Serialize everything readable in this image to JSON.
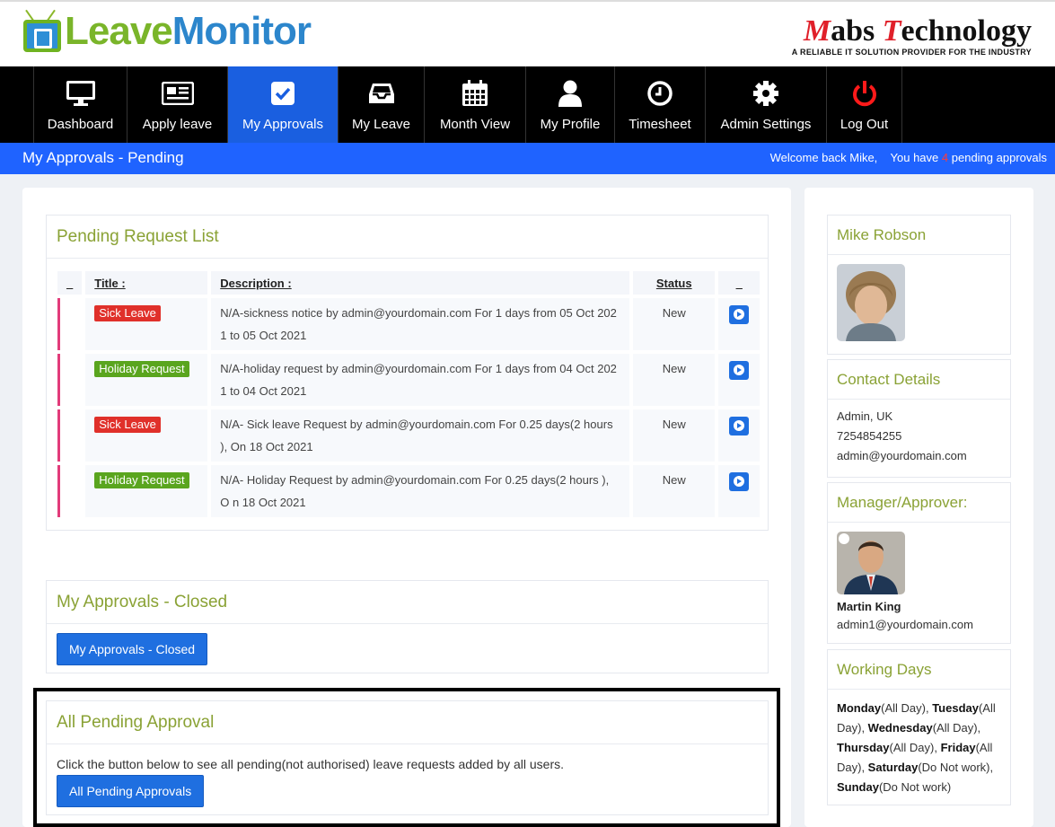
{
  "header": {
    "logo_part1": "Leave",
    "logo_part2": "Monitor",
    "brand_part1": "M",
    "brand_part2": "abs ",
    "brand_part3": "T",
    "brand_part4": "echnology",
    "brand_tagline": "A RELIABLE IT SOLUTION PROVIDER FOR THE INDUSTRY"
  },
  "nav": {
    "items": [
      {
        "label": "Dashboard",
        "icon": "monitor-icon"
      },
      {
        "label": "Apply leave",
        "icon": "newspaper-icon"
      },
      {
        "label": "My Approvals",
        "icon": "check-square-icon",
        "active": true
      },
      {
        "label": "My Leave",
        "icon": "inbox-icon"
      },
      {
        "label": "Month View",
        "icon": "calendar-icon"
      },
      {
        "label": "My Profile",
        "icon": "user-icon"
      },
      {
        "label": "Timesheet",
        "icon": "clock-icon"
      },
      {
        "label": "Admin Settings",
        "icon": "gear-icon"
      },
      {
        "label": "Log Out",
        "icon": "power-icon"
      }
    ]
  },
  "titlebar": {
    "page_title": "My Approvals - Pending",
    "welcome": "Welcome back Mike,",
    "you_have": "You have",
    "pending_count": "4",
    "pending_text": "pending approvals"
  },
  "pending": {
    "title": "Pending Request List",
    "columns": [
      "_",
      "Title :",
      "Description :",
      "Status",
      "_"
    ],
    "rows": [
      {
        "title": "Sick Leave",
        "type": "red",
        "desc": "N/A-sickness notice by admin@yourdomain.com For 1 days from 05 Oct 202 1 to 05 Oct 2021",
        "status": "New"
      },
      {
        "title": "Holiday Request",
        "type": "green",
        "desc": "N/A-holiday request by admin@yourdomain.com For 1 days from 04 Oct 202 1 to 04 Oct 2021",
        "status": "New"
      },
      {
        "title": "Sick Leave",
        "type": "red",
        "desc": "N/A- Sick leave Request by admin@yourdomain.com For 0.25 days(2 hours ), On 18 Oct 2021",
        "status": "New"
      },
      {
        "title": "Holiday Request",
        "type": "green",
        "desc": "N/A- Holiday Request by admin@yourdomain.com For 0.25 days(2 hours ), O n 18 Oct 2021",
        "status": "New"
      }
    ]
  },
  "closed": {
    "title": "My Approvals - Closed",
    "button": "My Approvals - Closed"
  },
  "all_pending": {
    "title": "All Pending Approval",
    "text": "Click the button below to see all pending(not authorised) leave requests added by all users.",
    "button": "All Pending Approvals"
  },
  "profile": {
    "name": "Mike Robson"
  },
  "contact": {
    "title": "Contact Details",
    "location": "Admin, UK",
    "phone": "7254854255",
    "email": "admin@yourdomain.com"
  },
  "manager": {
    "title": "Manager/Approver:",
    "name": "Martin King",
    "email": "admin1@yourdomain.com"
  },
  "working_days": {
    "title": "Working Days",
    "days": [
      {
        "day": "Monday",
        "value": "(All Day), "
      },
      {
        "day": "Tuesday",
        "value": "(All Day), "
      },
      {
        "day": "Wednesday",
        "value": "(All Day), "
      },
      {
        "day": "Thursday",
        "value": "(All Day), "
      },
      {
        "day": "Friday",
        "value": "(All Day), "
      },
      {
        "day": "Saturday",
        "value": "(Do Not work), "
      },
      {
        "day": "Sunday",
        "value": "(Do Not work)"
      }
    ]
  }
}
